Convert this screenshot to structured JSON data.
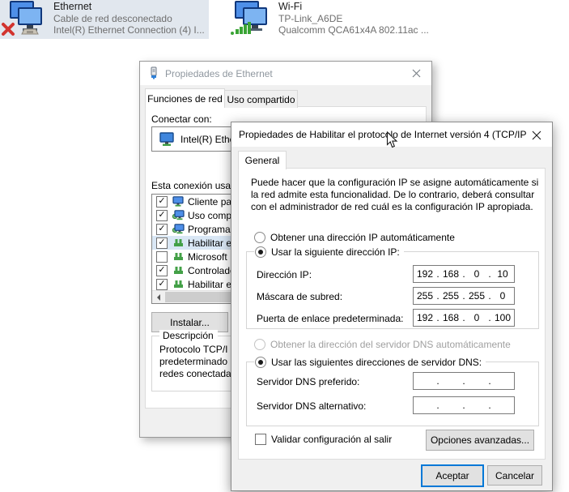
{
  "colors": {
    "accent": "#0078d7",
    "dialog_bg": "#f0f0f0",
    "list_selection": "#d9e7f5",
    "status_red": "#d2342f",
    "signal_green": "#3aa435"
  },
  "network_list": {
    "ethernet": {
      "name": "Ethernet",
      "status": "Cable de red desconectado",
      "device": "Intel(R) Ethernet Connection (4) I...",
      "icon": "ethernet-disconnected-icon"
    },
    "wifi": {
      "name": "Wi-Fi",
      "status": "TP-Link_A6DE",
      "device": "Qualcomm QCA61x4A 802.11ac ...",
      "icon": "wifi-signal-icon"
    }
  },
  "ethernet_dialog": {
    "title": "Propiedades de Ethernet",
    "tabs": {
      "network": "Funciones de red",
      "sharing": "Uso compartido"
    },
    "connect_label": "Conectar con:",
    "adapter_name": "Intel(R) Ethe",
    "uses_label": "Esta conexión usa l",
    "items": [
      {
        "label": "Cliente pa",
        "checked": true,
        "selected": false
      },
      {
        "label": "Uso comp",
        "checked": true,
        "selected": false
      },
      {
        "label": "Programad",
        "checked": true,
        "selected": false
      },
      {
        "label": "Habilitar el",
        "checked": true,
        "selected": true
      },
      {
        "label": "Microsoft ",
        "checked": false,
        "selected": false
      },
      {
        "label": "Controlado",
        "checked": true,
        "selected": false
      },
      {
        "label": "Habilitar el",
        "checked": true,
        "selected": false
      }
    ],
    "install_button": "Instalar...",
    "description_title": "Descripción",
    "description_lines": [
      "Protocolo TCP/I",
      "predeterminado",
      "redes conectada"
    ]
  },
  "ipv4_dialog": {
    "title": "Propiedades de Habilitar el protocolo de Internet versión 4 (TCP/IP...",
    "tab_general": "General",
    "intro": "Puede hacer que la configuración IP se asigne automáticamente si la red admite esta funcionalidad. De lo contrario, deberá consultar con el administrador de red cuál es la configuración IP apropiada.",
    "sep": ".",
    "radio_auto_ip": "Obtener una dirección IP automáticamente",
    "radio_use_ip": "Usar la siguiente dirección IP:",
    "ip_fields": [
      {
        "label": "Dirección IP:",
        "octets": [
          "192",
          "168",
          "0",
          "10"
        ]
      },
      {
        "label": "Máscara de subred:",
        "octets": [
          "255",
          "255",
          "255",
          "0"
        ]
      },
      {
        "label": "Puerta de enlace predeterminada:",
        "octets": [
          "192",
          "168",
          "0",
          "100"
        ]
      }
    ],
    "radio_auto_dns": "Obtener la dirección del servidor DNS automáticamente",
    "radio_use_dns": "Usar las siguientes direcciones de servidor DNS:",
    "dns_fields": [
      {
        "label": "Servidor DNS preferido:",
        "octets": [
          "",
          "",
          "",
          ""
        ]
      },
      {
        "label": "Servidor DNS alternativo:",
        "octets": [
          "",
          "",
          "",
          ""
        ]
      }
    ],
    "validate_label": "Validar configuración al salir",
    "advanced_button": "Opciones avanzadas...",
    "ok_button": "Aceptar",
    "cancel_button": "Cancelar"
  }
}
